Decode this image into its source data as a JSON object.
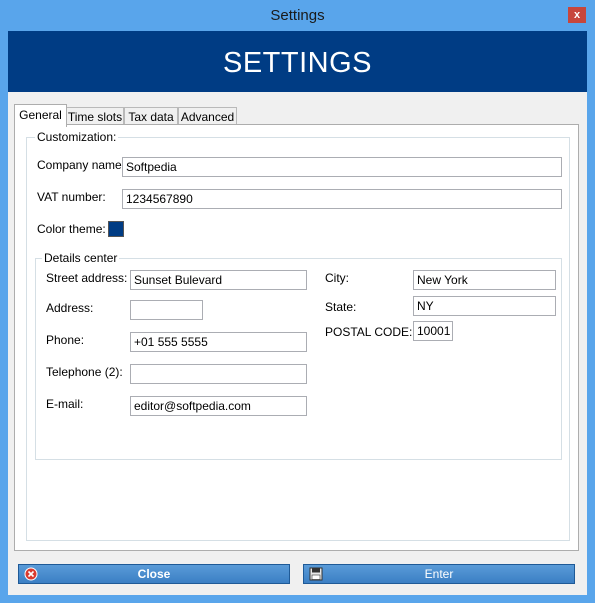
{
  "window": {
    "title": "Settings",
    "close_glyph": "x"
  },
  "banner": {
    "heading": "SETTINGS"
  },
  "tabs": [
    {
      "label": "General",
      "active": true
    },
    {
      "label": "Time slots",
      "active": false
    },
    {
      "label": "Tax data",
      "active": false
    },
    {
      "label": "Advanced",
      "active": false
    }
  ],
  "customization": {
    "legend": "Customization:",
    "company_name_label": "Company name:",
    "company_name_value": "Softpedia",
    "vat_label": "VAT number:",
    "vat_value": "1234567890",
    "color_theme_label": "Color theme:",
    "color_theme_value": "#003c84"
  },
  "details": {
    "legend": "Details center",
    "street_label": "Street address:",
    "street_value": "Sunset Bulevard",
    "address_label": "Address:",
    "address_value": "",
    "phone_label": "Phone:",
    "phone_value": "+01 555 5555",
    "telephone2_label": "Telephone (2):",
    "telephone2_value": "",
    "email_label": "E-mail:",
    "email_value": "editor@softpedia.com",
    "city_label": "City:",
    "city_value": "New York",
    "state_label": "State:",
    "state_value": "NY",
    "postal_label": "POSTAL CODE:",
    "postal_value": "10001"
  },
  "footer": {
    "close_label": "Close",
    "close_icon": "close-circle-icon",
    "enter_label": "Enter",
    "enter_icon": "floppy-disk-icon"
  },
  "colors": {
    "title_bar": "#59a5eb",
    "banner": "#003c84",
    "button": "#3b7fc4"
  }
}
